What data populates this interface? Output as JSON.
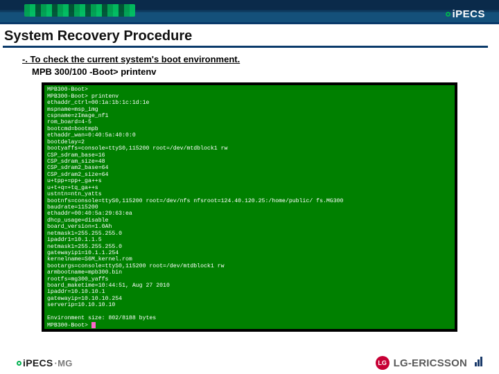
{
  "top_logo": "iPECS",
  "heading": "System Recovery Procedure",
  "sub1": "-. To check the current system's boot environment.",
  "sub2": "MPB 300/100 -Boot> printenv",
  "footer_left_brand": "iPECS",
  "footer_left_suffix": "·MG",
  "footer_right": "LG-ERICSSON",
  "lg_face": "LG",
  "terminal_lines": [
    "MPB300-Boot>",
    "MPB300-Boot> printenv",
    "ethaddr_ctrl=00:1a:1b:1c:1d:1e",
    "mspname=msp_img",
    "cspname=zImage_nf1",
    "rom_board=4-5",
    "bootcmd=bootmpb",
    "ethaddr_wan=0:40:5a:40:0:0",
    "bootdelay=2",
    "bootyaffs=console=ttyS0,115200 root=/dev/mtdblock1 rw",
    "CSP_sdram_base=16",
    "CSP_sdram_size=48",
    "CSP_sdram2_base=64",
    "CSP_sdram2_size=64",
    "u+tpp+=pp+_ga++s",
    "u+t+q=+tq_ga++s",
    "ustntn=ntn_yatts",
    "bootnfs=console=ttyS0,115200 root=/dev/nfs nfsroot=124.40.120.25:/home/public/ fs.MG300",
    "baudrate=115200",
    "ethaddr=00:40:5a:29:63:ea",
    "dhcp_usage=disable",
    "board_version=1.0Ah",
    "netmask1=255.255.255.0",
    "ipaddr1=10.1.1.5",
    "netmask1=255.255.255.0",
    "gatewayip1=10.1.1.254",
    "kernelname=S6M_kernel.rom",
    "bootargs=console=ttyS0,115200 root=/dev/mtdblock1 rw",
    "armbootname=mpb300.bin",
    "rootfs=mg300_yaffs",
    "board_maketime=10:44:51, Aug 27 2010",
    "ipaddr=10.10.10.1",
    "gatewayip=10.10.10.254",
    "serverip=10.10.10.10",
    "",
    "Environment size: 802/8188 bytes",
    "MPB300-Boot> "
  ]
}
